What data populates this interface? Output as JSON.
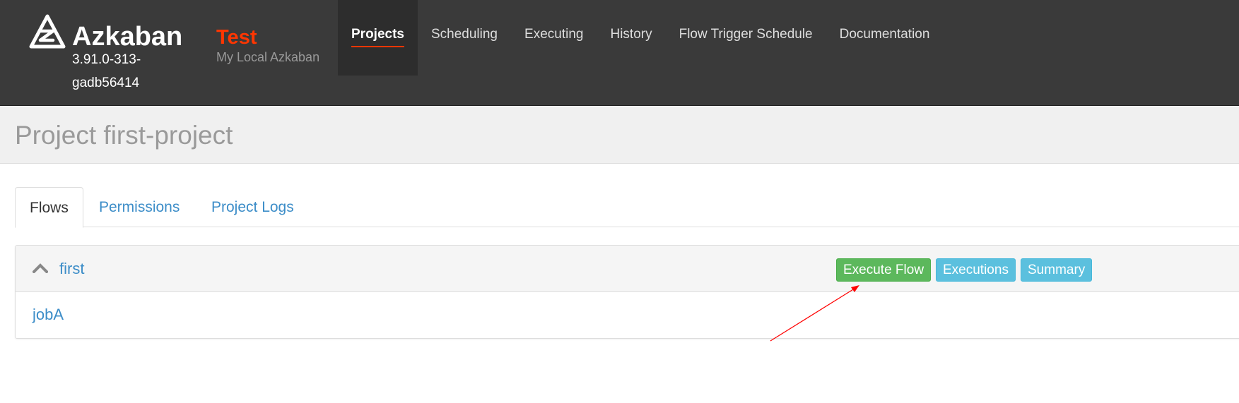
{
  "navbar": {
    "brand": {
      "name": "Azkaban",
      "version": "3.91.0-313-gadb56414"
    },
    "environment": {
      "name": "Test",
      "description": "My Local Azkaban"
    },
    "nav_items": [
      {
        "label": "Projects"
      },
      {
        "label": "Scheduling"
      },
      {
        "label": "Executing"
      },
      {
        "label": "History"
      },
      {
        "label": "Flow Trigger Schedule"
      },
      {
        "label": "Documentation"
      }
    ],
    "active_item": "Projects"
  },
  "page": {
    "title": "Project first-project"
  },
  "tabs": [
    {
      "label": "Flows"
    },
    {
      "label": "Permissions"
    },
    {
      "label": "Project Logs"
    }
  ],
  "active_tab": "Flows",
  "flow": {
    "name": "first",
    "buttons": {
      "execute": "Execute Flow",
      "executions": "Executions",
      "summary": "Summary"
    },
    "jobs": [
      "jobA"
    ]
  },
  "colors": {
    "navbar_bg": "#3a3a3a",
    "accent": "#ff3601",
    "link": "#3c8dc8",
    "success": "#5cb85c",
    "info": "#5bc0de",
    "annotation_arrow": "#ff0000"
  },
  "icons": {
    "logo": "azkaban-logo-icon",
    "flow_toggle": "chevron-up-icon"
  }
}
